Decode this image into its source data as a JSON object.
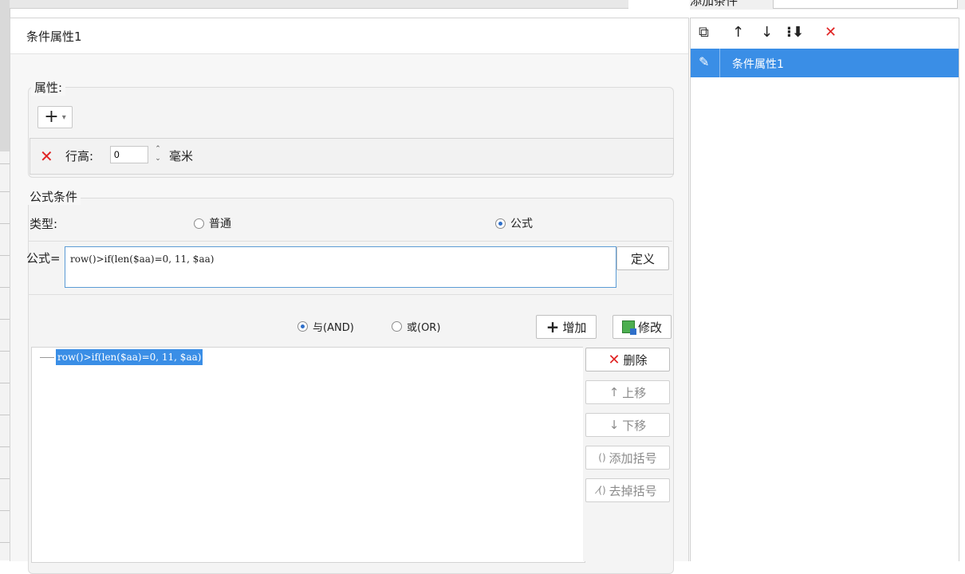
{
  "top_right": {
    "label": "添加条件"
  },
  "dialog": {
    "title": "条件属性1"
  },
  "attributes": {
    "legend": "属性:",
    "add_symbol": "+",
    "dropdown_arrow": "▾",
    "row_height_label": "行高:",
    "row_height_value": "0",
    "unit": "毫米"
  },
  "formula_condition": {
    "legend": "公式条件",
    "type_label": "类型:",
    "type_options": [
      {
        "label": "普通",
        "checked": false
      },
      {
        "label": "公式",
        "checked": true
      }
    ],
    "formula_label": "公式=",
    "formula_value": "row()>if(len($aa)=0, 11, $aa)",
    "define_button": "定义",
    "logic_options": [
      {
        "label": "与(AND)",
        "checked": true
      },
      {
        "label": "或(OR)",
        "checked": false
      }
    ],
    "add_button": "增加",
    "modify_button": "修改",
    "conditions": [
      "row()>if(len($aa)=0, 11, $aa)"
    ],
    "delete_button": "删除",
    "move_up_button": "上移",
    "move_down_button": "下移",
    "add_bracket_button": "添加括号",
    "remove_bracket_button": "去掉括号"
  },
  "condition_list": {
    "items": [
      {
        "label": "条件属性1",
        "selected": true
      }
    ]
  },
  "colors": {
    "accent": "#3a8ee6",
    "danger": "#e02424"
  }
}
